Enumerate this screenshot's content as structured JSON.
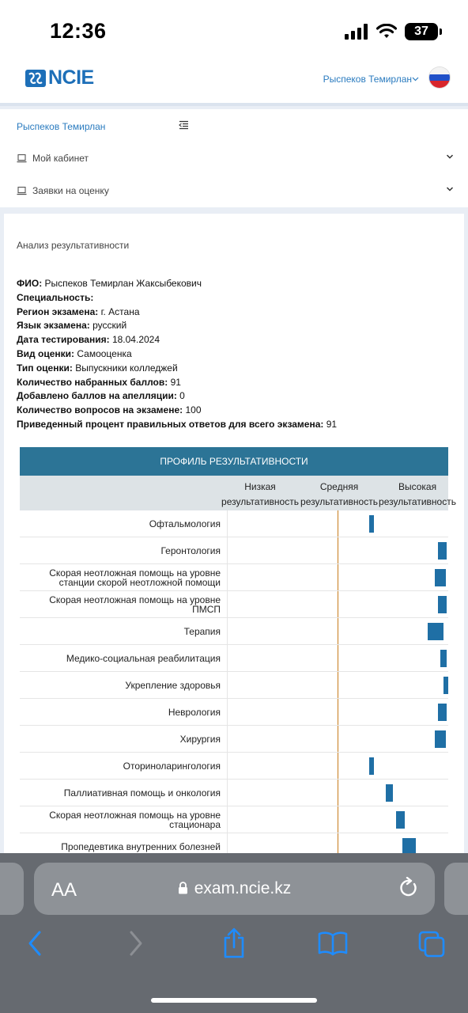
{
  "status_bar": {
    "time": "12:36",
    "battery": "37"
  },
  "header": {
    "logo_text": "NCIE",
    "user_name": "Рыспеков Темирлан",
    "language": "ru"
  },
  "sidebar": {
    "user_name": "Рыспеков Темирлан",
    "items": [
      {
        "label": "Мой кабинет"
      },
      {
        "label": "Заявки на оценку"
      }
    ]
  },
  "content": {
    "title": "Анализ результативности",
    "info": [
      {
        "label": "ФИО:",
        "value": "Рыспеков Темирлан Жаксыбекович"
      },
      {
        "label": "Специальность:",
        "value": ""
      },
      {
        "label": "Регион экзамена:",
        "value": "г. Астана"
      },
      {
        "label": "Язык экзамена:",
        "value": "русский"
      },
      {
        "label": "Дата тестирования:",
        "value": "18.04.2024"
      },
      {
        "label": "Вид оценки:",
        "value": "Самооценка"
      },
      {
        "label": "Тип оценки:",
        "value": "Выпускники колледжей"
      },
      {
        "label": "Количество набранных баллов:",
        "value": "91"
      },
      {
        "label": "Добавлено баллов на апелляции:",
        "value": "0"
      },
      {
        "label": "Количество вопросов на экзамене:",
        "value": "100"
      },
      {
        "label": "Приведенный процент правильных ответов для всего экзамена:",
        "value": "91"
      }
    ]
  },
  "profile": {
    "title": "ПРОФИЛЬ РЕЗУЛЬТАТИВНОСТИ",
    "levels": [
      {
        "line1": "Низкая",
        "line2": "результативность"
      },
      {
        "line1": "Средняя",
        "line2": "результативность"
      },
      {
        "line1": "Высокая",
        "line2": "результативность"
      }
    ]
  },
  "chart_data": {
    "type": "bar",
    "title": "ПРОФИЛЬ РЕЗУЛЬТАТИВНОСТИ",
    "categories": [
      "Офтальмология",
      "Геронтология",
      "Скорая неотложная помощь на уровне станции скорой неотложной помощи",
      "Скорая неотложная помощь на уровне ПМСП",
      "Терапия",
      "Медико-социальная реабилитация",
      "Укрепление здоровья",
      "Неврология",
      "Хирургия",
      "Оториноларингология",
      "Паллиативная помощь и онкология",
      "Скорая неотложная помощь на уровне стационара",
      "Пропедевтика внутренних болезней"
    ],
    "series": [
      {
        "name": "center",
        "values": [
          0.65,
          0.97,
          0.96,
          0.97,
          0.94,
          0.975,
          0.985,
          0.97,
          0.96,
          0.65,
          0.73,
          0.78,
          0.82
        ]
      },
      {
        "name": "width",
        "values": [
          0.02,
          0.04,
          0.05,
          0.04,
          0.07,
          0.03,
          0.02,
          0.04,
          0.05,
          0.02,
          0.03,
          0.04,
          0.06
        ]
      },
      {
        "name": "height",
        "values": [
          0.65,
          0.65,
          0.65,
          0.65,
          0.65,
          0.65,
          0.65,
          0.65,
          0.65,
          0.65,
          0.65,
          0.65,
          0.65
        ]
      }
    ],
    "reference_line": 0.5,
    "xlim": [
      0,
      1
    ],
    "color": "#1f6fa5",
    "ref_color": "#c77c1c"
  },
  "browser": {
    "aa": "AA",
    "url": "exam.ncie.kz"
  }
}
